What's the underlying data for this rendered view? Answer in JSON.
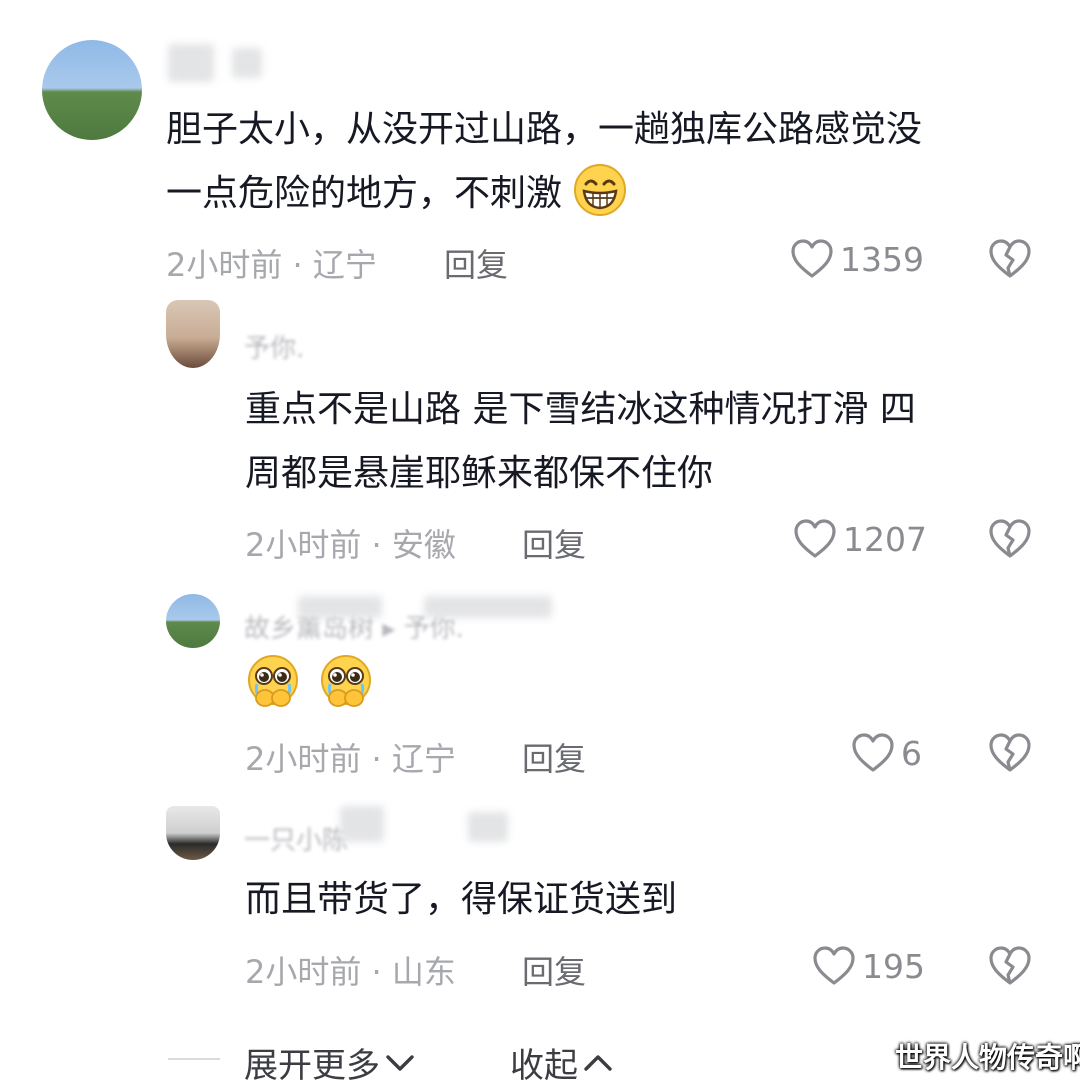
{
  "comments": [
    {
      "username": "",
      "text_line1": "胆子太小，从没开过山路，一趟独库公路感觉没",
      "text_line2": "一点危险的地方，不刺激",
      "emoji": "grinning-face",
      "time": "2小时前",
      "location": "辽宁",
      "reply_label": "回复",
      "likes": "1359"
    },
    {
      "username": "予你.",
      "text_line1": "重点不是山路 是下雪结冰这种情况打滑 四",
      "text_line2": "周都是悬崖耶稣来都保不住你",
      "time": "2小时前",
      "location": "安徽",
      "reply_label": "回复",
      "likes": "1207"
    },
    {
      "username": "故乡薰岛树 ▸ 予你.",
      "emoji": "pleading-face-hands-over-mouth",
      "time": "2小时前",
      "location": "辽宁",
      "reply_label": "回复",
      "likes": "6"
    },
    {
      "username": "一只小陈",
      "text_line1": "而且带货了，得保证货送到",
      "time": "2小时前",
      "location": "山东",
      "reply_label": "回复",
      "likes": "195"
    }
  ],
  "meta_separator": " · ",
  "footer": {
    "expand_label": "展开更多",
    "collapse_label": "收起"
  },
  "watermark": "世界人物传奇啊"
}
